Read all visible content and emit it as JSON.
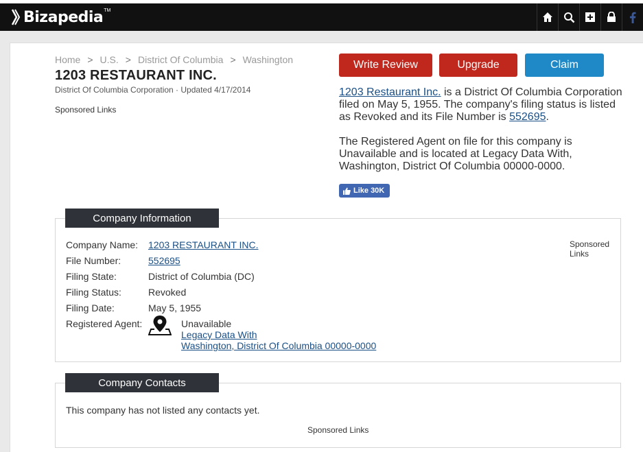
{
  "header": {
    "logo_text": "Bizapedia",
    "logo_tm": "TM",
    "icons": [
      "home-icon",
      "search-icon",
      "add-icon",
      "lock-icon",
      "facebook-icon"
    ]
  },
  "breadcrumb": {
    "items": [
      "Home",
      "U.S.",
      "District Of Columbia",
      "Washington"
    ],
    "separator": ">"
  },
  "company": {
    "title": "1203 RESTAURANT INC.",
    "subtitle": "District Of Columbia Corporation · Updated 4/17/2014"
  },
  "sponsored_label": "Sponsored Links",
  "buttons": {
    "write_review": "Write Review",
    "upgrade": "Upgrade",
    "claim": "Claim"
  },
  "description": {
    "p1_link": "1203 Restaurant Inc.",
    "p1_text": " is a District Of Columbia Corporation filed on May 5, 1955. The company's filing status is listed as Revoked and its File Number is ",
    "p1_file_link": "552695",
    "p1_end": ".",
    "p2": "The Registered Agent on file for this company is Unavailable and is located at Legacy Data With, Washington, District Of Columbia 00000-0000."
  },
  "like": {
    "label": "Like 30K"
  },
  "company_info": {
    "heading": "Company Information",
    "rows": [
      {
        "label": "Company Name:",
        "value": "1203 RESTAURANT INC."
      },
      {
        "label": "File Number:",
        "value": "552695"
      },
      {
        "label": "Filing State:",
        "value": "District of Columbia (DC)"
      },
      {
        "label": "Filing Status:",
        "value": "Revoked"
      },
      {
        "label": "Filing Date:",
        "value": "May 5, 1955"
      }
    ],
    "agent": {
      "label": "Registered Agent:",
      "name": "Unavailable",
      "address_line1": "Legacy Data With",
      "address_line2": "Washington, District Of Columbia 00000-0000"
    },
    "sponsored_line1": "Sponsored",
    "sponsored_line2": "Links"
  },
  "company_contacts": {
    "heading": "Company Contacts",
    "empty_text": "This company has not listed any contacts yet."
  },
  "colors": {
    "red_button": "#c0281d",
    "blue_button": "#1f89c7",
    "facebook": "#4267b2",
    "link": "#1a4f86",
    "header_bg": "#111111"
  }
}
